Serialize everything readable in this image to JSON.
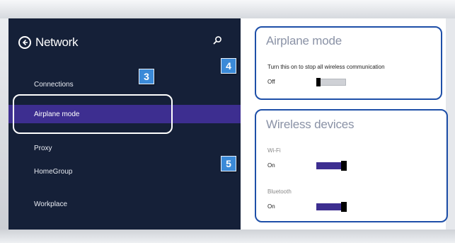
{
  "header": {
    "title": "Network"
  },
  "icons": {
    "back": "back-arrow-icon",
    "search": "search-icon"
  },
  "nav": {
    "items": [
      {
        "label": "Connections",
        "selected": false
      },
      {
        "label": "Airplane mode",
        "selected": true
      },
      {
        "label": "Proxy",
        "selected": false
      },
      {
        "label": "HomeGroup",
        "selected": false
      },
      {
        "label": "Workplace",
        "selected": false
      }
    ]
  },
  "airplane": {
    "title": "Airplane mode",
    "description": "Turn this on to stop all wireless communication",
    "state_label": "Off",
    "is_on": false
  },
  "wireless": {
    "title": "Wireless devices",
    "wifi": {
      "label": "Wi-Fi",
      "state_label": "On",
      "is_on": true
    },
    "bluetooth": {
      "label": "Bluetooth",
      "state_label": "On",
      "is_on": true
    }
  },
  "callouts": {
    "nav": "3",
    "airplane": "4",
    "wireless": "5"
  },
  "colors": {
    "panel_bg": "#152038",
    "selected_bg": "#3d2e90",
    "callout_border": "#1e4fa8",
    "badge_bg": "#3b8ad8",
    "toggle_on": "#3d2e90"
  }
}
